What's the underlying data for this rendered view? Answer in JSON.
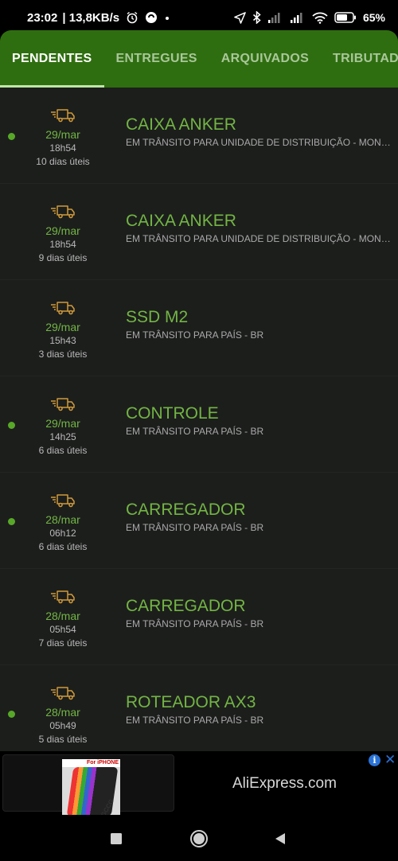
{
  "statusbar": {
    "time": "23:02",
    "network_speed": "| 13,8KB/s",
    "battery": "65",
    "battery_suffix": "%"
  },
  "tabs": [
    {
      "label": "PENDENTES",
      "active": true
    },
    {
      "label": "ENTREGUES"
    },
    {
      "label": "ARQUIVADOS"
    },
    {
      "label": "TRIBUTAD"
    }
  ],
  "items": [
    {
      "date": "29/mar",
      "time": "18h54",
      "days": "10 dias úteis",
      "title": "CAIXA ANKER",
      "status": "EM TRÂNSITO PARA UNIDADE DE DISTRIBUIÇÃO - MONTE...",
      "unread": true
    },
    {
      "date": "29/mar",
      "time": "18h54",
      "days": "9 dias úteis",
      "title": "CAIXA ANKER",
      "status": "EM TRÂNSITO PARA UNIDADE DE DISTRIBUIÇÃO - MONTE...",
      "unread": false
    },
    {
      "date": "29/mar",
      "time": "15h43",
      "days": "3 dias úteis",
      "title": "SSD M2",
      "status": "EM TRÂNSITO PARA PAÍS - BR",
      "unread": false
    },
    {
      "date": "29/mar",
      "time": "14h25",
      "days": "6 dias úteis",
      "title": "CONTROLE",
      "status": "EM TRÂNSITO PARA PAÍS - BR",
      "unread": true
    },
    {
      "date": "28/mar",
      "time": "06h12",
      "days": "6 dias úteis",
      "title": "CARREGADOR",
      "status": "EM TRÂNSITO PARA PAÍS - BR",
      "unread": true
    },
    {
      "date": "28/mar",
      "time": "05h54",
      "days": "7 dias úteis",
      "title": "CARREGADOR",
      "status": "EM TRÂNSITO PARA PAÍS - BR",
      "unread": false
    },
    {
      "date": "28/mar",
      "time": "05h49",
      "days": "5 dias úteis",
      "title": "ROTEADOR AX3",
      "status": "EM TRÂNSITO PARA PAÍS - BR",
      "unread": true
    }
  ],
  "ad": {
    "label": "AliExpress.com",
    "image_caption": "For iPHONE",
    "image_brand": "GCCG",
    "info_icon": "info-icon",
    "close_icon": "close-icon"
  },
  "navbar": {
    "recents_icon": "square-icon",
    "home_icon": "circle-icon",
    "back_icon": "triangle-icon"
  },
  "colors": {
    "appbar": "#2f6e10",
    "accent_green": "#73b544",
    "list_bg": "#1c1e1c",
    "dot": "#58a828",
    "ad_blue": "#2a72d6"
  }
}
